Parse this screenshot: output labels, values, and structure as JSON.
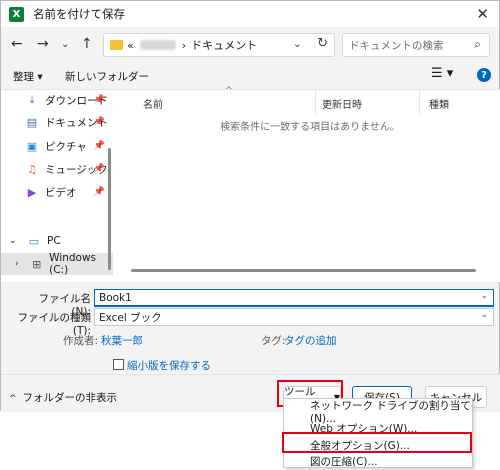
{
  "titlebar": {
    "app_icon": "excel-icon",
    "logo_text": "X",
    "title": "名前を付けて保存",
    "close_icon": "close-icon"
  },
  "navbar": {
    "back_icon": "arrow-left-icon",
    "forward_icon": "arrow-right-icon",
    "recent_icon": "chevron-down-icon",
    "up_icon": "arrow-up-icon",
    "address_prefix": "«",
    "address_sep": "›",
    "address_last": "ドキュメント",
    "search_placeholder": "ドキュメントの検索"
  },
  "cmdbar": {
    "organize": "整理 ▾",
    "new_folder": "新しいフォルダー"
  },
  "sidebar": {
    "items": [
      {
        "label": "ダウンロード",
        "icon": "download-icon",
        "glyph": "⤓",
        "color": "#2b7bd1",
        "pinned": true
      },
      {
        "label": "ドキュメント",
        "icon": "document-icon",
        "glyph": "▤",
        "color": "#4a6fa5",
        "pinned": true
      },
      {
        "label": "ピクチャ",
        "icon": "picture-icon",
        "glyph": "▣",
        "color": "#2a8bd1",
        "pinned": true
      },
      {
        "label": "ミュージック",
        "icon": "music-icon",
        "glyph": "♫",
        "color": "#e46a34",
        "pinned": true
      },
      {
        "label": "ビデオ",
        "icon": "video-icon",
        "glyph": "▶",
        "color": "#8a46c8",
        "pinned": true
      }
    ],
    "pc_label": "PC",
    "drive_label": "Windows (C:)"
  },
  "filelist": {
    "columns": [
      "名前",
      "更新日時",
      "種類"
    ],
    "empty_message": "検索条件に一致する項目はありません。"
  },
  "form": {
    "filename_label": "ファイル名(N):",
    "filename_value": "Book1",
    "filetype_label": "ファイルの種類(T):",
    "filetype_value": "Excel ブック",
    "author_label": "作成者:",
    "author_value": "秋葉一郎",
    "tags_label": "タグ:",
    "tags_value": "タグの追加",
    "thumbnail_label": "縮小版を保存する"
  },
  "footer": {
    "hide_folders": "フォルダーの非表示",
    "tools": "ツール(L)",
    "save": "保存(S)",
    "cancel": "キャンセル"
  },
  "tools_menu": {
    "items": [
      "ネットワーク ドライブの割り当て(N)...",
      "Web オプション(W)...",
      "全般オプション(G)...",
      "図の圧縮(C)..."
    ]
  },
  "colors": {
    "accent": "#0067c0",
    "highlight_red": "#e60012",
    "excel_green": "#107c41"
  }
}
